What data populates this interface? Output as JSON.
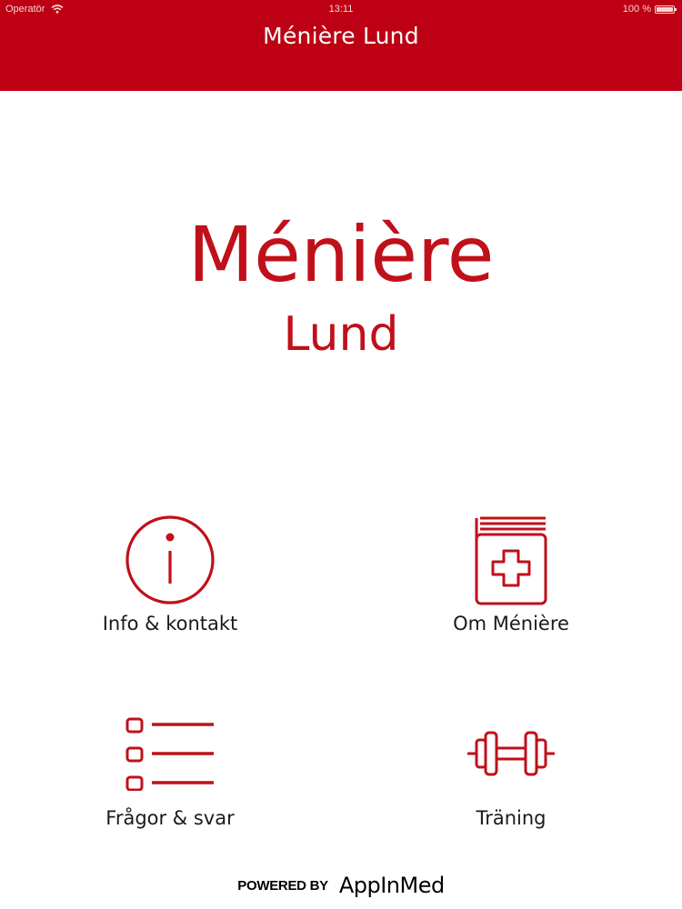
{
  "status_bar": {
    "carrier": "Operatör",
    "time": "13:11",
    "battery": "100 %"
  },
  "nav": {
    "title": "Ménière Lund"
  },
  "logo": {
    "main": "Ménière",
    "sub": "Lund"
  },
  "menu": {
    "info": "Info & kontakt",
    "om": "Om Ménière",
    "fragor": "Frågor & svar",
    "traning": "Träning"
  },
  "icons": {
    "info": "info-circle-icon",
    "om": "medical-book-icon",
    "fragor": "list-icon",
    "traning": "dumbbell-icon"
  },
  "footer": {
    "powered_by": "POWERED BY",
    "brand": "AppInMed"
  },
  "colors": {
    "brand_red": "#bd0013",
    "icon_red": "#c0101a"
  }
}
